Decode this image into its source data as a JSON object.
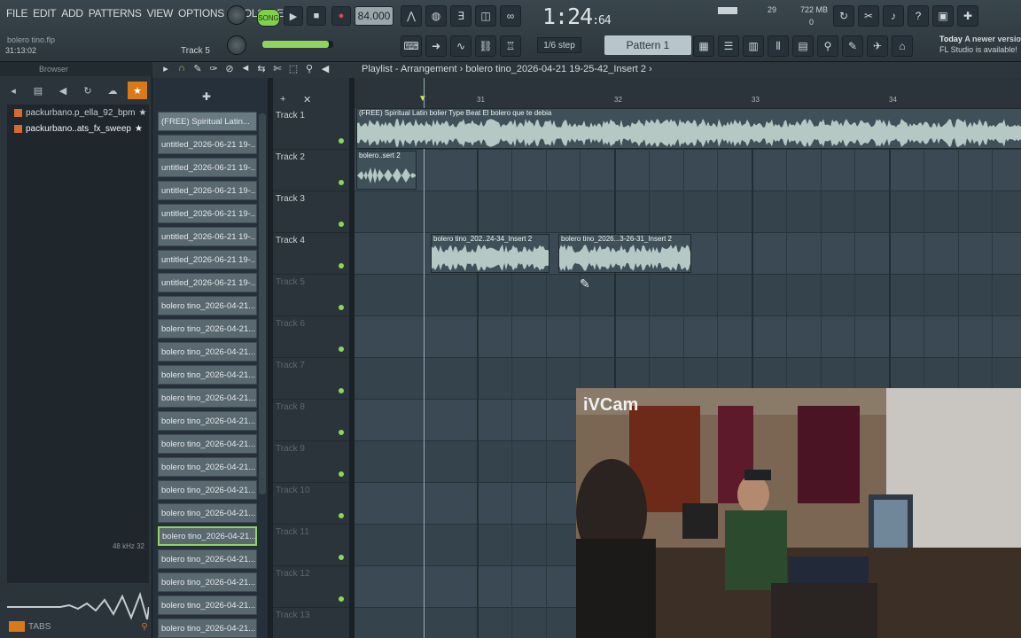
{
  "menu": [
    "FILE",
    "EDIT",
    "ADD",
    "PATTERNS",
    "VIEW",
    "OPTIONS",
    "TOOLS",
    "HELP"
  ],
  "song": {
    "name": "bolero tino.flp",
    "time": "31:13:02",
    "track": "Track 5"
  },
  "transport": {
    "song_label": "SONG",
    "tempo": "84.000",
    "clock": "1:24",
    "clock_sub": "64",
    "step": "1/6 step",
    "pattern": "Pattern 1"
  },
  "memory": {
    "cpu": "29",
    "ram": "722 MB",
    "poly": "0"
  },
  "news": {
    "line1_prefix": "Today",
    "line1": "A newer versio",
    "line2": "FL Studio is available!"
  },
  "browser": {
    "title": "Browser",
    "files": [
      "packurbano.p_ella_92_bpm",
      "packurbano..ats_fx_sweep"
    ],
    "wave_info": "48 kHz 32",
    "tabs_label": "TABS"
  },
  "playlist": {
    "title": "Playlist - Arrangement",
    "project": "bolero tino_2026-04-21 19-25-42_Insert 2",
    "ruler": [
      "31",
      "32",
      "33",
      "34"
    ],
    "patterns": [
      "(FREE) Spiritual Latin...",
      "untitled_2026-06-21 19-...",
      "untitled_2026-06-21 19-...",
      "untitled_2026-06-21 19-...",
      "untitled_2026-06-21 19-...",
      "untitled_2026-06-21 19-...",
      "untitled_2026-06-21 19-...",
      "untitled_2026-06-21 19-...",
      "bolero tino_2026-04-21...",
      "bolero tino_2026-04-21...",
      "bolero tino_2026-04-21...",
      "bolero tino_2026-04-21...",
      "bolero tino_2026-04-21...",
      "bolero tino_2026-04-21...",
      "bolero tino_2026-04-21...",
      "bolero tino_2026-04-21...",
      "bolero tino_2026-04-21...",
      "bolero tino_2026-04-21...",
      "bolero tino_2026-04-21...",
      "bolero tino_2026-04-21...",
      "bolero tino_2026-04-21...",
      "bolero tino_2026-04-21...",
      "bolero tino_2026-04-21..."
    ],
    "tracks": [
      "Track 1",
      "Track 2",
      "Track 3",
      "Track 4",
      "Track 5",
      "Track 6",
      "Track 7",
      "Track 8",
      "Track 9",
      "Track 10",
      "Track 11",
      "Track 12",
      "Track 13"
    ],
    "clips": {
      "c1": "(FREE) Spiritual Latin bolier Type Beat El bolero que te debia",
      "c2": "bolero..sert 2",
      "c3": "bolero tino_202..24-34_Insert 2",
      "c4": "bolero tino_2026...3-26-31_Insert 2"
    }
  },
  "webcam": {
    "label": "iVCam"
  }
}
